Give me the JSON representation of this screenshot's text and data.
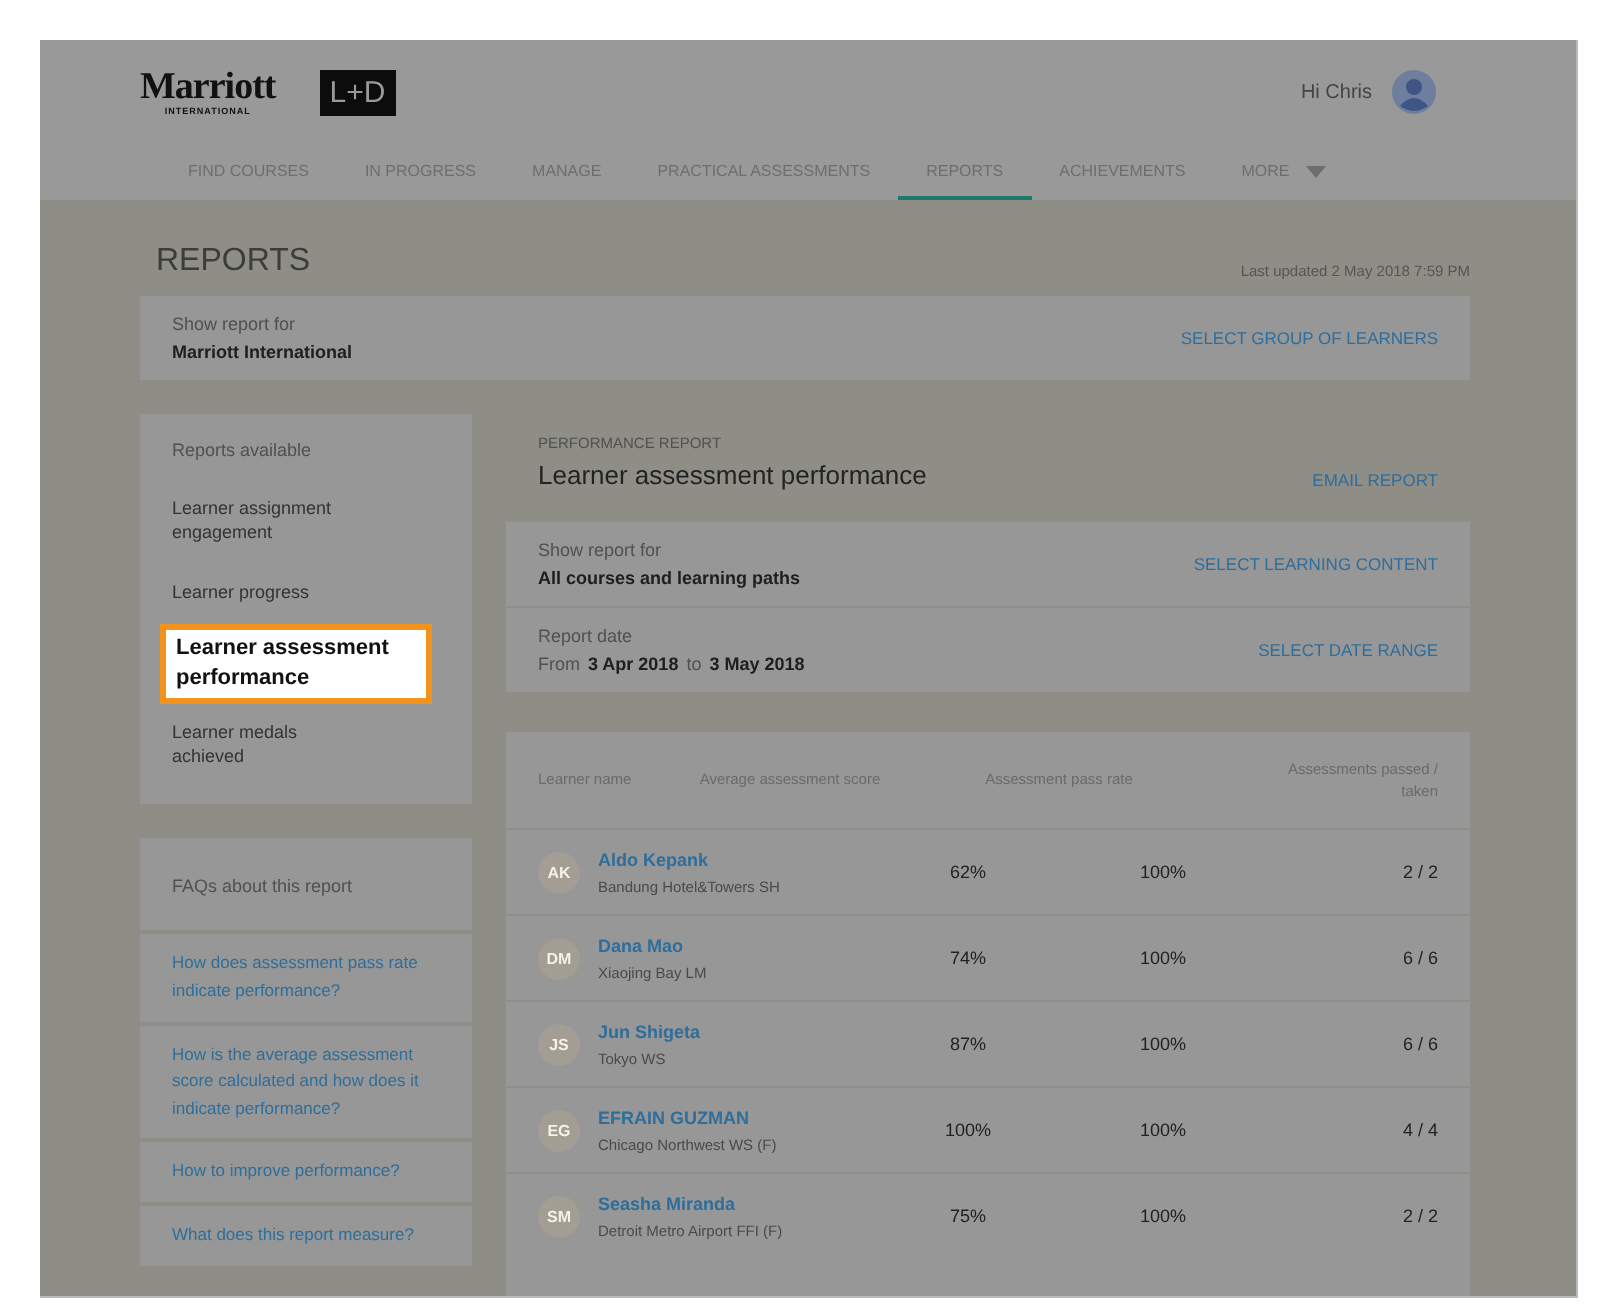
{
  "header": {
    "logo": {
      "name": "Marriott",
      "sub": "INTERNATIONAL"
    },
    "badge": "L+D",
    "greeting": "Hi Chris"
  },
  "nav": [
    {
      "label": "FIND COURSES",
      "selected": false
    },
    {
      "label": "IN PROGRESS",
      "selected": false
    },
    {
      "label": "MANAGE",
      "selected": false
    },
    {
      "label": "PRACTICAL ASSESSMENTS",
      "selected": false
    },
    {
      "label": "REPORTS",
      "selected": true
    },
    {
      "label": "ACHIEVEMENTS",
      "selected": false
    },
    {
      "label": "MORE",
      "selected": false,
      "kind": "dropdown"
    }
  ],
  "page": {
    "title": "REPORTS",
    "last_updated": "Last updated 2 May 2018 7:59 PM"
  },
  "group_filter": {
    "label": "Show report for",
    "value": "Marriott International",
    "action": "SELECT GROUP OF LEARNERS"
  },
  "sidebar": {
    "heading": "Reports available",
    "items": [
      {
        "label": "Learner assignment engagement",
        "selected": false
      },
      {
        "label": "Learner progress",
        "selected": false
      },
      {
        "label": "Learner assessment performance",
        "selected": true
      },
      {
        "label": "Learner medals achieved",
        "selected": false
      }
    ]
  },
  "faq": {
    "heading": "FAQs about this report",
    "links": [
      "How does assessment pass rate indicate performance?",
      "How is the average assessment score calculated and how does it indicate performance?",
      "How to improve performance?",
      "What does this report measure?"
    ]
  },
  "report": {
    "kicker": "PERFORMANCE REPORT",
    "title": "Learner assessment performance",
    "action": "EMAIL REPORT",
    "filters": [
      {
        "label": "Show report for",
        "value": "All courses and learning paths",
        "action": "SELECT LEARNING CONTENT",
        "kind": "text"
      },
      {
        "label": "Report date",
        "from_word": "From",
        "from": "3 Apr 2018",
        "to_word": "to",
        "to": "3 May 2018",
        "action": "SELECT DATE RANGE",
        "kind": "range"
      }
    ]
  },
  "table": {
    "columns": [
      "Learner name",
      "Average assessment score",
      "Assessment pass rate",
      "Assessments passed / taken"
    ],
    "rows": [
      {
        "initials": "AK",
        "name": "Aldo Kepank",
        "location": "Bandung Hotel&Towers SH",
        "score": "62%",
        "pass_rate": "100%",
        "passed": "2 / 2"
      },
      {
        "initials": "DM",
        "name": "Dana Mao",
        "location": "Xiaojing Bay LM",
        "score": "74%",
        "pass_rate": "100%",
        "passed": "6 / 6"
      },
      {
        "initials": "JS",
        "name": "Jun Shigeta",
        "location": "Tokyo WS",
        "score": "87%",
        "pass_rate": "100%",
        "passed": "6 / 6"
      },
      {
        "initials": "EG",
        "name": "EFRAIN GUZMAN",
        "location": "Chicago Northwest WS (F)",
        "score": "100%",
        "pass_rate": "100%",
        "passed": "4 / 4"
      },
      {
        "initials": "SM",
        "name": "Seasha Miranda",
        "location": "Detroit Metro Airport FFI (F)",
        "score": "75%",
        "pass_rate": "100%",
        "passed": "2 / 2"
      }
    ]
  }
}
